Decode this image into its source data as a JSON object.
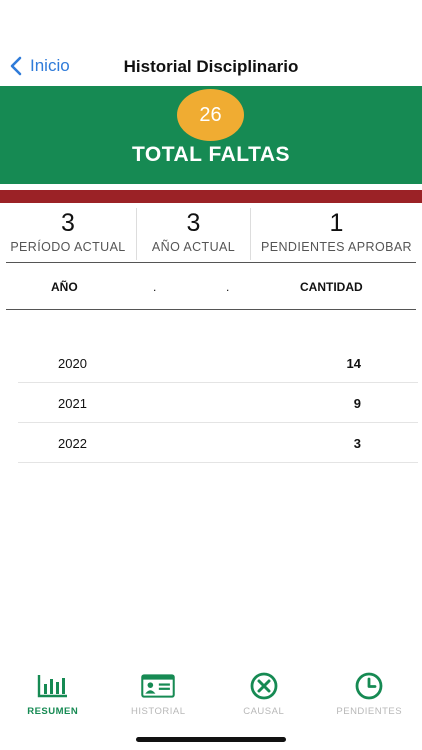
{
  "nav": {
    "back_label": "Inicio",
    "title": "Historial Disciplinario"
  },
  "summary": {
    "total_count": "26",
    "total_label": "TOTAL FALTAS"
  },
  "stats": [
    {
      "value": "3",
      "label": "PERÍODO ACTUAL"
    },
    {
      "value": "3",
      "label": "AÑO ACTUAL"
    },
    {
      "value": "1",
      "label": "PENDIENTES APROBAR"
    }
  ],
  "table": {
    "headers": {
      "year": "AÑO",
      "dot1": ".",
      "dot2": ".",
      "quantity": "CANTIDAD"
    },
    "rows": [
      {
        "year": "2020",
        "quantity": "14"
      },
      {
        "year": "2021",
        "quantity": "9"
      },
      {
        "year": "2022",
        "quantity": "3"
      }
    ]
  },
  "tabs": [
    {
      "label": "RESUMEN",
      "icon": "bar-chart-icon",
      "active": true
    },
    {
      "label": "HISTORIAL",
      "icon": "id-card-icon",
      "active": false
    },
    {
      "label": "CAUSAL",
      "icon": "circle-x-icon",
      "active": false
    },
    {
      "label": "PENDIENTES",
      "icon": "clock-icon",
      "active": false
    }
  ],
  "colors": {
    "green": "#168a53",
    "red": "#9b2226",
    "badge": "#f0ac32",
    "link": "#2f7bd9",
    "inactive": "#b8b8b8"
  }
}
